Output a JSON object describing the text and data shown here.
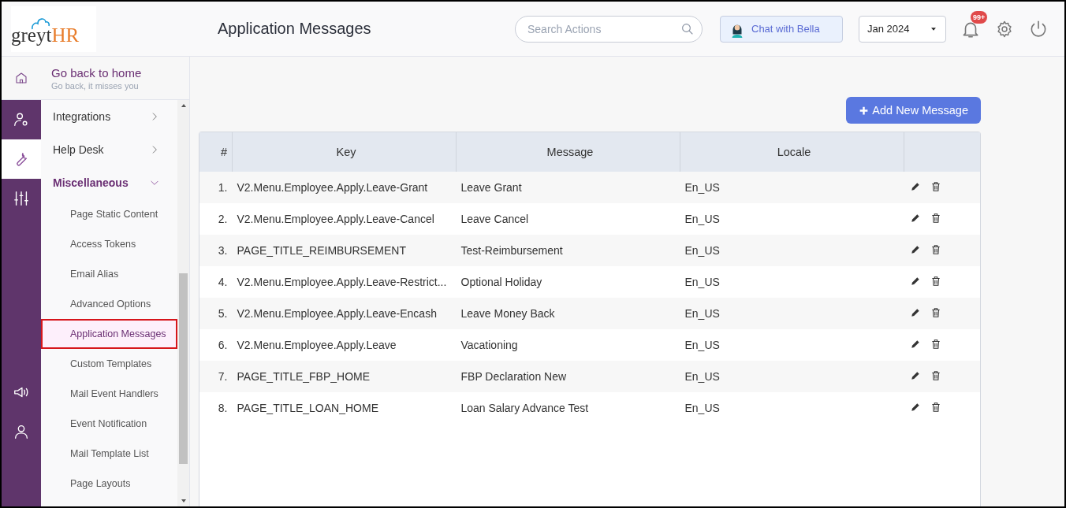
{
  "header": {
    "logo": {
      "part_1": "greyt",
      "part_2": "HR"
    },
    "title": "Application Messages",
    "search": {
      "placeholder": "Search Actions"
    },
    "chat_button": "Chat with Bella",
    "month": "Jan 2024",
    "notification_badge": "99+"
  },
  "rail": [
    {
      "kind": "admin",
      "selected": false
    },
    {
      "kind": "tools",
      "selected": true
    },
    {
      "kind": "sliders",
      "selected": false
    },
    {
      "kind": "speaker",
      "selected": false
    },
    {
      "kind": "person",
      "selected": false
    }
  ],
  "back_home": {
    "title": "Go back to home",
    "subtitle": "Go back, it misses you"
  },
  "nav": [
    {
      "label": "Integrations",
      "expanded": false
    },
    {
      "label": "Help Desk",
      "expanded": false
    },
    {
      "label": "Miscellaneous",
      "expanded": true,
      "children": [
        {
          "label": "Page Static Content",
          "selected": false
        },
        {
          "label": "Access Tokens",
          "selected": false
        },
        {
          "label": "Email Alias",
          "selected": false
        },
        {
          "label": "Advanced Options",
          "selected": false
        },
        {
          "label": "Application Messages",
          "selected": true
        },
        {
          "label": "Custom Templates",
          "selected": false
        },
        {
          "label": "Mail Event Handlers",
          "selected": false
        },
        {
          "label": "Event Notification",
          "selected": false
        },
        {
          "label": "Mail Template List",
          "selected": false
        },
        {
          "label": "Page Layouts",
          "selected": false
        }
      ]
    }
  ],
  "add_button": "Add New Message",
  "table": {
    "columns": [
      "#",
      "Key",
      "Message",
      "Locale"
    ],
    "rows": [
      {
        "index": "1.",
        "key": "V2.Menu.Employee.Apply.Leave-Grant",
        "message": "Leave Grant",
        "locale": "En_US"
      },
      {
        "index": "2.",
        "key": "V2.Menu.Employee.Apply.Leave-Cancel",
        "message": "Leave Cancel",
        "locale": "En_US"
      },
      {
        "index": "3.",
        "key": "PAGE_TITLE_REIMBURSEMENT",
        "message": "Test-Reimbursement",
        "locale": "En_US"
      },
      {
        "index": "4.",
        "key": "V2.Menu.Employee.Apply.Leave-Restrict...",
        "message": "Optional Holiday",
        "locale": "En_US"
      },
      {
        "index": "5.",
        "key": "V2.Menu.Employee.Apply.Leave-Encash",
        "message": "Leave Money Back",
        "locale": "En_US"
      },
      {
        "index": "6.",
        "key": "V2.Menu.Employee.Apply.Leave",
        "message": "Vacationing",
        "locale": "En_US"
      },
      {
        "index": "7.",
        "key": "PAGE_TITLE_FBP_HOME",
        "message": "FBP Declaration New",
        "locale": "En_US"
      },
      {
        "index": "8.",
        "key": "PAGE_TITLE_LOAN_HOME",
        "message": "Loan Salary Advance Test",
        "locale": "En_US"
      }
    ]
  }
}
